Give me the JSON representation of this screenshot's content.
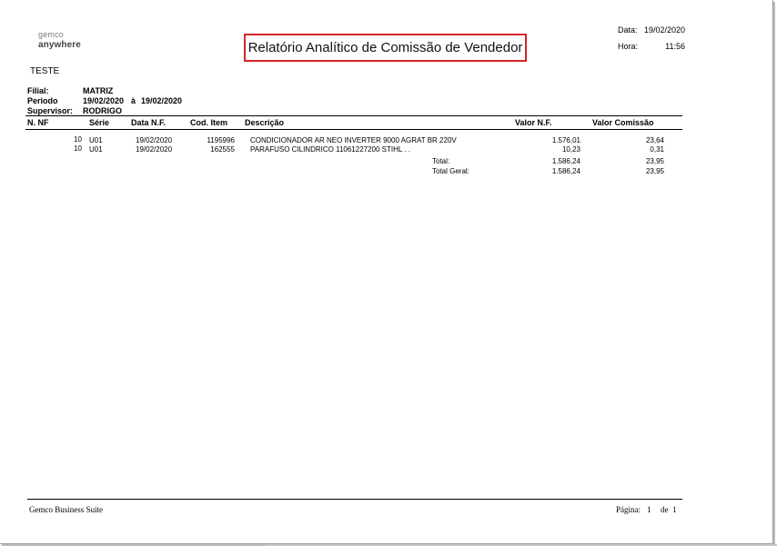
{
  "header": {
    "logo_line1": "gemco",
    "logo_line2": "anywhere",
    "title": "Relatório Analítico de Comissão de Vendedor",
    "date_label": "Data:",
    "date_value": "19/02/2020",
    "time_label": "Hora:",
    "time_value": "11:56"
  },
  "company": "TESTE",
  "filters": {
    "filial_label": "Filial:",
    "filial_value": "MATRIZ",
    "periodo_label": "Periodo",
    "periodo_start": "19/02/2020",
    "periodo_sep": "à",
    "periodo_end": "19/02/2020",
    "supervisor_label": "Supervisor:",
    "supervisor_value": "RODRIGO"
  },
  "columns": {
    "nnf": "N. NF",
    "serie": "Série",
    "data_nf": "Data N.F.",
    "cod_item": "Cod. Item",
    "descricao": "Descrição",
    "valor_nf": "Valor N.F.",
    "valor_comissao": "Valor Comissão"
  },
  "rows": [
    {
      "nnf": "10",
      "serie": "U01",
      "data_nf": "19/02/2020",
      "cod_item": "1195996",
      "descricao": "CONDICIONADOR AR NEO INVERTER 9000 AGRAT  BR 220V",
      "valor_nf": "1.576,01",
      "valor_comissao": "23,64"
    },
    {
      "nnf": "10",
      "serie": "U01",
      "data_nf": "19/02/2020",
      "cod_item": "162555",
      "descricao": "PARAFUSO CILINDRICO 11061227200 STIHL  . .",
      "valor_nf": "10,23",
      "valor_comissao": "0,31"
    }
  ],
  "totals": {
    "total_label": "Total:",
    "total_nf": "1.586,24",
    "total_comissao": "23,95",
    "geral_label": "Total Geral:",
    "geral_nf": "1.586,24",
    "geral_comissao": "23,95"
  },
  "footer": {
    "brand": "Gemco Business Suite",
    "page_label": "Página:",
    "page_current": "1",
    "page_of": "de",
    "page_total": "1"
  }
}
